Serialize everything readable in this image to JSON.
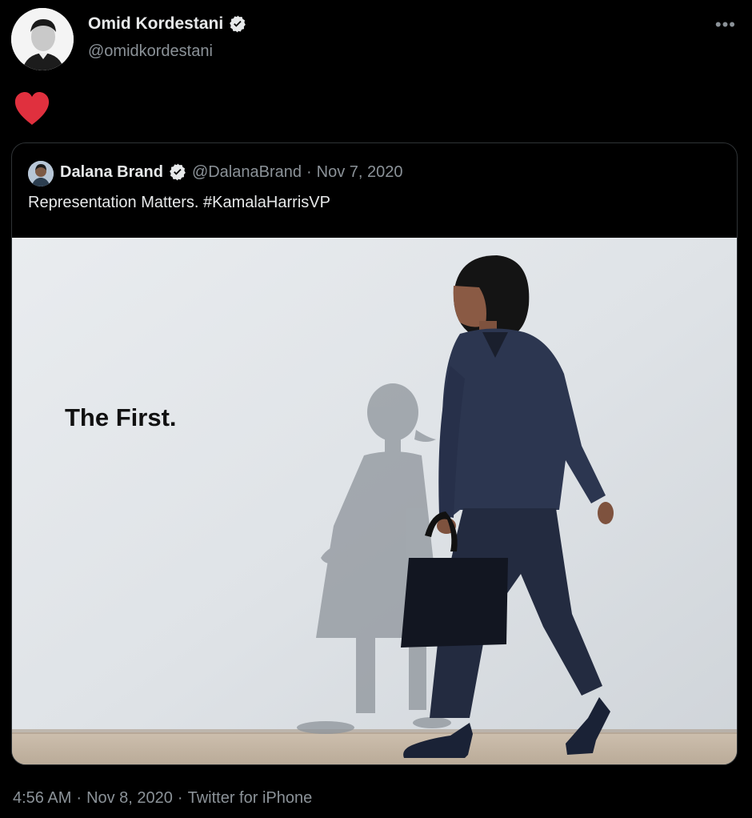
{
  "author": {
    "name": "Omid Kordestani",
    "handle": "@omidkordestani",
    "verified": true
  },
  "tweet": {
    "emoji": "heart",
    "more_label": "•••"
  },
  "quoted": {
    "name": "Dalana Brand",
    "verified": true,
    "handle": "@DalanaBrand",
    "separator": "·",
    "date": "Nov 7, 2020",
    "text": "Representation Matters. #KamalaHarrisVP",
    "media": {
      "caption": "The First.",
      "icon": "photo"
    }
  },
  "footer": {
    "time": "4:56 AM",
    "date": "Nov 8, 2020",
    "source": "Twitter for iPhone",
    "separator": "·"
  },
  "colors": {
    "background": "#000000",
    "text_primary": "#e7e9ea",
    "text_secondary": "#8b9298",
    "border": "#2f3336",
    "heart": "#e0303e",
    "verified_badge": "#e7e9ea"
  }
}
